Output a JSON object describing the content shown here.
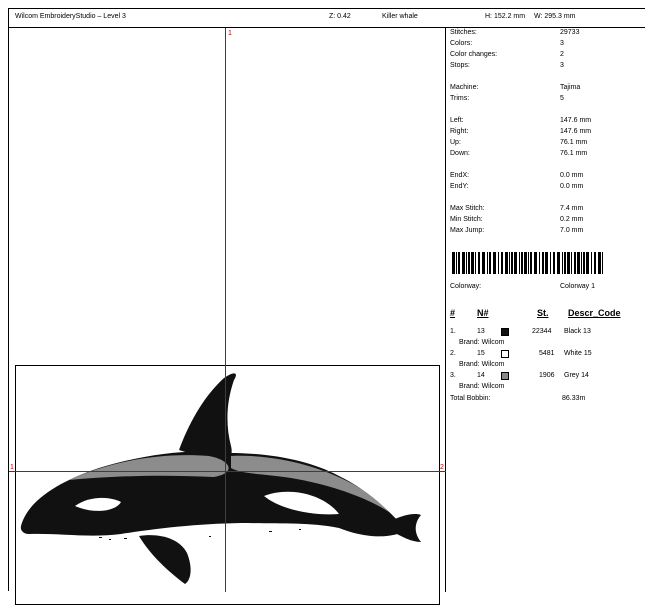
{
  "header": {
    "app_title": "Wilcom EmbroideryStudio – Level 3",
    "zoom": "Z: 0.42",
    "design_name": "Killer whale",
    "height": "H: 152.2 mm",
    "width": "W: 295.3 mm"
  },
  "canvas": {
    "marker_top": "1",
    "marker_left": "1",
    "marker_right": "2"
  },
  "stats": [
    {
      "label": "Stitches:",
      "value": "29733"
    },
    {
      "label": "Colors:",
      "value": "3"
    },
    {
      "label": "Color changes:",
      "value": "2"
    },
    {
      "label": "Stops:",
      "value": "3"
    },
    {
      "label": "Machine:",
      "value": "Tajima"
    },
    {
      "label": "Trims:",
      "value": "5"
    },
    {
      "label": "Left:",
      "value": "147.6 mm"
    },
    {
      "label": "Right:",
      "value": "147.6 mm"
    },
    {
      "label": "Up:",
      "value": "76.1 mm"
    },
    {
      "label": "Down:",
      "value": "76.1 mm"
    },
    {
      "label": "EndX:",
      "value": "0.0 mm"
    },
    {
      "label": "EndY:",
      "value": "0.0 mm"
    },
    {
      "label": "Max Stitch:",
      "value": "7.4 mm"
    },
    {
      "label": "Min Stitch:",
      "value": "0.2 mm"
    },
    {
      "label": "Max Jump:",
      "value": "7.0 mm"
    }
  ],
  "colorway": {
    "label": "Colorway:",
    "value": "Colorway 1"
  },
  "table": {
    "headers": {
      "idx": "#",
      "num": "N#",
      "st": "St.",
      "descr": "Descr_Code"
    },
    "rows": [
      {
        "idx": "1.",
        "num": "13",
        "st": "22344",
        "descr": "Black 13",
        "brand": "Brand: Wilcom",
        "swatch": "#111111"
      },
      {
        "idx": "2.",
        "num": "15",
        "st": "5481",
        "descr": "White 15",
        "brand": "Brand: Wilcom",
        "swatch": "#ffffff"
      },
      {
        "idx": "3.",
        "num": "14",
        "st": "1906",
        "descr": "Grey 14",
        "brand": "Brand: Wilcom",
        "swatch": "#888888"
      }
    ],
    "total_label": "Total Bobbin:",
    "total_value": "86.33m"
  }
}
